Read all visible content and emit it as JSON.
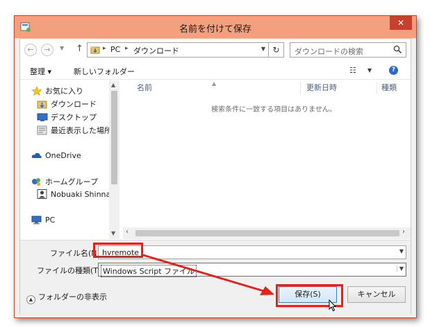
{
  "window": {
    "title": "名前を付けて保存",
    "close_glyph": "✕"
  },
  "address": {
    "back_glyph": "←",
    "forward_glyph": "→",
    "up_glyph": "↑",
    "parts": [
      "PC",
      "ダウンロード"
    ],
    "refresh_glyph": "↻"
  },
  "search": {
    "placeholder": "ダウンロードの検索"
  },
  "toolbar": {
    "organize": "整理 ▾",
    "new_folder": "新しいフォルダー"
  },
  "nav": {
    "items": [
      {
        "label": "お気に入り",
        "icon": "star-icon"
      },
      {
        "label": "ダウンロード",
        "icon": "downloads-folder-icon"
      },
      {
        "label": "デスクトップ",
        "icon": "desktop-icon"
      },
      {
        "label": "最近表示した場所",
        "icon": "recent-places-icon"
      },
      {
        "label": "OneDrive",
        "icon": "cloud-icon"
      },
      {
        "label": "ホームグループ",
        "icon": "homegroup-icon"
      },
      {
        "label": "Nobuaki Shinna",
        "icon": "user-icon"
      },
      {
        "label": "PC",
        "icon": "computer-icon"
      }
    ]
  },
  "filelist": {
    "columns": [
      "名前",
      "更新日時",
      "種類"
    ],
    "empty_message": "検索条件に一致する項目はありません。"
  },
  "form": {
    "filename_label": "ファイル名(N):",
    "filename_value": "hvremote",
    "filetype_label": "ファイルの種類(T):",
    "filetype_value": "Windows Script ファイル"
  },
  "footer": {
    "hide_folders": "フォルダーの非表示",
    "save_button": "保存(S)",
    "cancel_button": "キャンセル"
  },
  "colors": {
    "titlebar": "#f4a07e",
    "close": "#c7402d",
    "annotation": "#e8201c"
  }
}
